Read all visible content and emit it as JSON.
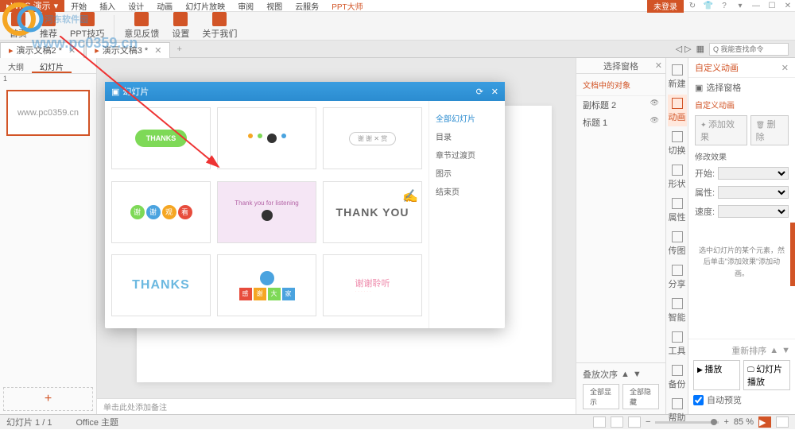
{
  "app": {
    "name": "WPS 演示",
    "login": "未登录"
  },
  "menu": [
    "开始",
    "插入",
    "设计",
    "动画",
    "幻灯片放映",
    "审阅",
    "视图",
    "云服务",
    "PPT大师"
  ],
  "toolbar": [
    {
      "label": "首页"
    },
    {
      "label": "推荐"
    },
    {
      "label": "PPT技巧"
    },
    {
      "label": "意见反馈"
    },
    {
      "label": "设置"
    },
    {
      "label": "关于我们"
    }
  ],
  "tabs": [
    {
      "label": "演示文稿2 *"
    },
    {
      "label": "演示文稿3 *"
    }
  ],
  "tab_extras": {
    "nav": "◁ ▷",
    "search_placeholder": "Q 我能查找命令"
  },
  "left_panel": {
    "tabs": [
      "大纲",
      "幻灯片"
    ],
    "thumb_text": "www.pc0359.cn"
  },
  "popup": {
    "title": "幻灯片",
    "categories": [
      "全部幻灯片",
      "目录",
      "章节过渡页",
      "图示",
      "结束页"
    ],
    "templates": [
      {
        "text": "THANKS",
        "style": "bubble"
      },
      {
        "text": "",
        "style": "icons-row"
      },
      {
        "text": "",
        "style": "badge"
      },
      {
        "text": "谢谢观看",
        "style": "circles"
      },
      {
        "text": "Thank you for listening",
        "style": "character"
      },
      {
        "text": "THANK YOU",
        "style": "hand"
      },
      {
        "text": "THANKS",
        "style": "outline"
      },
      {
        "text": "感谢大家",
        "style": "squares"
      },
      {
        "text": "谢谢聆听",
        "style": "dots"
      }
    ]
  },
  "notes": "单击此处添加备注",
  "right_panel": {
    "title": "选择窗格",
    "section": "文档中的对象",
    "items": [
      {
        "name": "副标题 2"
      },
      {
        "name": "标题 1"
      }
    ],
    "layer": {
      "label": "叠放次序",
      "btns": [
        "全部显示",
        "全部隐藏"
      ]
    }
  },
  "side_tools": [
    "新建",
    "动画",
    "切换",
    "形状",
    "属性",
    "传图",
    "分享",
    "智能",
    "工具",
    "备份",
    "帮助"
  ],
  "anim_panel": {
    "title": "自定义动画",
    "select_label": "选择窗格",
    "custom": "自定义动画",
    "buttons": [
      "添加效果",
      "删除"
    ],
    "modify": "修改效果",
    "fields": [
      {
        "label": "开始:"
      },
      {
        "label": "属性:"
      },
      {
        "label": "速度:"
      }
    ],
    "msg": "选中幻灯片的某个元素，然后单击\"添加效果\"添加动画。",
    "reorder": "重新排序",
    "play": "播放",
    "slideshow": "幻灯片播放",
    "autoprev": "自动预览"
  },
  "status": {
    "page": "幻灯片 1 / 1",
    "theme": "Office 主题",
    "zoom": "85 %"
  },
  "watermark": {
    "text": "河东软件园",
    "url": "www.pc0359.cn"
  }
}
